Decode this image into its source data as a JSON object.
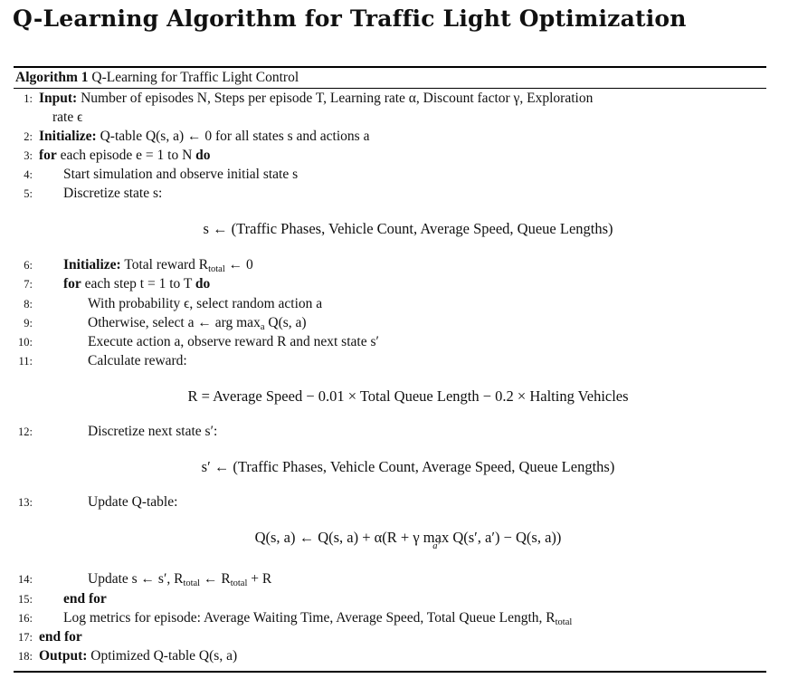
{
  "title": "Q-Learning Algorithm for Traffic Light Optimization",
  "algorithm": {
    "label": "Algorithm 1",
    "name": "Q-Learning for Traffic Light Control"
  },
  "lines": {
    "l1": {
      "num": "1:",
      "kw": "Input:",
      "text": "Number of episodes N, Steps per episode T, Learning rate α, Discount factor γ, Exploration",
      "cont": "rate ϵ"
    },
    "l2": {
      "num": "2:",
      "kw": "Initialize:",
      "text": "Q-table Q(s, a) ← 0 for all states s and actions a"
    },
    "l3": {
      "num": "3:",
      "kw": "for",
      "text": "each episode e = 1 to N",
      "kw2": "do"
    },
    "l4": {
      "num": "4:",
      "text": "Start simulation and observe initial state s"
    },
    "l5": {
      "num": "5:",
      "text": "Discretize state s:"
    },
    "d1": "s ← (Traffic Phases, Vehicle Count, Average Speed, Queue Lengths)",
    "l6": {
      "num": "6:",
      "kw": "Initialize:",
      "text_a": "Total reward R",
      "sub": "total",
      "text_b": " ← 0"
    },
    "l7": {
      "num": "7:",
      "kw": "for",
      "text": "each step t = 1 to T",
      "kw2": "do"
    },
    "l8": {
      "num": "8:",
      "text": "With probability ϵ, select random action a"
    },
    "l9": {
      "num": "9:",
      "text_a": "Otherwise, select a ← arg max",
      "sub": "a",
      "text_b": " Q(s, a)"
    },
    "l10": {
      "num": "10:",
      "text": "Execute action a, observe reward R and next state s′"
    },
    "l11": {
      "num": "11:",
      "text": "Calculate reward:"
    },
    "d2": "R = Average Speed − 0.01 × Total Queue Length − 0.2 × Halting Vehicles",
    "l12": {
      "num": "12:",
      "text": "Discretize next state s′:"
    },
    "d3": "s′ ← (Traffic Phases, Vehicle Count, Average Speed, Queue Lengths)",
    "l13": {
      "num": "13:",
      "text": "Update Q-table:"
    },
    "d4": {
      "a": "Q(s, a) ← Q(s, a) + α(R + γ ",
      "max": "max",
      "under": "a′",
      "b": " Q(s′, a′) − Q(s, a))"
    },
    "l14": {
      "num": "14:",
      "text_a": "Update s ← s′, R",
      "sub1": "total",
      "text_b": " ← R",
      "sub2": "total",
      "text_c": " + R"
    },
    "l15": {
      "num": "15:",
      "kw": "end for"
    },
    "l16": {
      "num": "16:",
      "text_a": "Log metrics for episode: Average Waiting Time, Average Speed, Total Queue Length, R",
      "sub": "total"
    },
    "l17": {
      "num": "17:",
      "kw": "end for"
    },
    "l18": {
      "num": "18:",
      "kw": "Output:",
      "text": "Optimized Q-table Q(s, a)"
    }
  }
}
